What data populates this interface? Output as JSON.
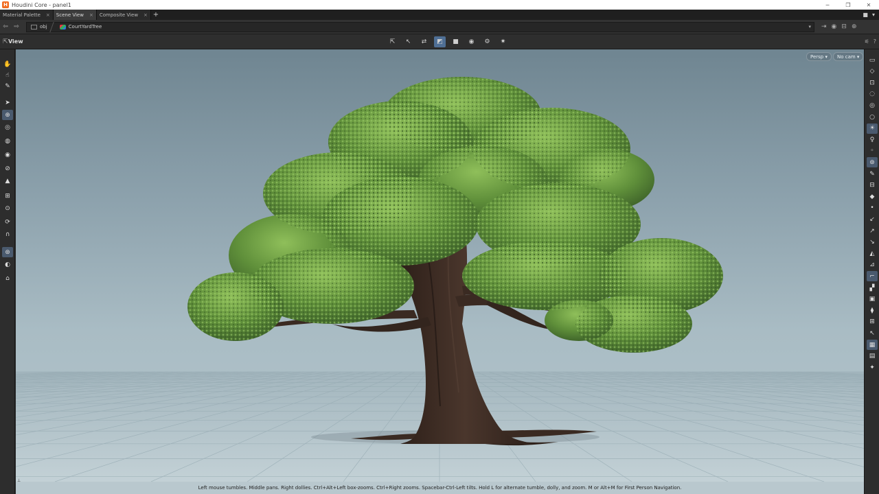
{
  "window": {
    "title": "Houdini Core - panel1",
    "minimize": "─",
    "restore": "❐",
    "close": "✕"
  },
  "tabs": [
    {
      "label": "Material Palette",
      "close": "×"
    },
    {
      "label": "Scene View",
      "close": "×"
    },
    {
      "label": "Composite View",
      "close": "×"
    }
  ],
  "tab_add": "+",
  "path": {
    "back": "⇦",
    "forward": "⇨",
    "level1": "obj",
    "level2": "CourtYardTree",
    "dropdown": "▾"
  },
  "viewer": {
    "label": "View",
    "persp_label": "Persp ▾",
    "cam_label": "No cam ▾",
    "status_text": "Left mouse tumbles. Middle pans. Right dollies. Ctrl+Alt+Left box-zooms. Ctrl+Right zooms. Spacebar-Ctrl-Left tilts. Hold L for alternate tumble, dolly, and zoom.     M or Alt+M for First Person Navigation."
  },
  "icons": {
    "houdini_logo": "H",
    "view_tools": [
      "⇱",
      "↖",
      "⇄",
      "◩",
      "■",
      "◉",
      "⚙",
      "✷"
    ],
    "left_tools": [
      "✋",
      "☝",
      "✎",
      "➤",
      "⊕",
      "◎",
      "◍",
      "◉",
      "⊘",
      "▲",
      "⊞",
      "⊙",
      "⟳",
      "∩",
      "⊛",
      "◐",
      "⌂"
    ],
    "right_tools": [
      "▭",
      "◇",
      "⊡",
      "◌",
      "◎",
      "○",
      "☀",
      "♀",
      "◦",
      "⊛",
      "✎",
      "⊟",
      "◆",
      "•",
      "↙",
      "↗",
      "↘",
      "◭",
      "⊿",
      "⌐",
      "▞",
      "▣",
      "⧫",
      "⊞",
      "↖",
      "▦",
      "▤",
      "✦"
    ]
  },
  "colors": {
    "accent": "#4f6f95",
    "viewport_top": "#6f8591",
    "viewport_bottom": "#b4c6cd",
    "foliage": "#5f8f3a",
    "trunk": "#3d2b22"
  }
}
